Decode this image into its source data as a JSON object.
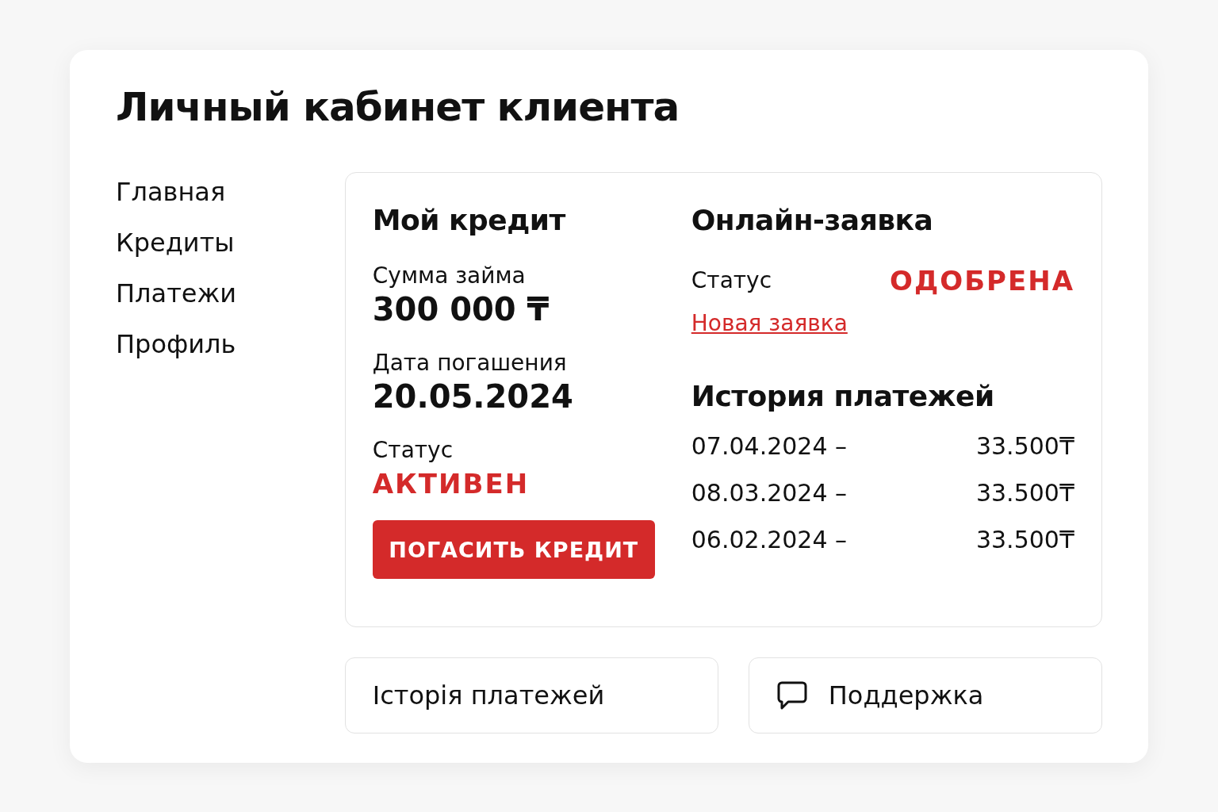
{
  "title": "Личный кабинет клиента",
  "sidebar": {
    "items": [
      {
        "label": "Главная"
      },
      {
        "label": "Кредиты"
      },
      {
        "label": "Платежи"
      },
      {
        "label": "Профиль"
      }
    ]
  },
  "credit": {
    "heading": "Мой кредит",
    "amount_label": "Сумма займа",
    "amount": "300 000 ₸",
    "date_label": "Дата погашения",
    "date": "20.05.2024",
    "status_label": "Статус",
    "status": "АКТИВЕН",
    "button": "ПОГАСИТЬ КРЕДИТ"
  },
  "application": {
    "heading": "Онлайн-заявка",
    "status_label": "Статус",
    "status": "ОДОБРЕНА",
    "link": "Новая заявка"
  },
  "history": {
    "heading": "История платежей",
    "rows": [
      {
        "date": "07.04.2024 –",
        "amount": "33.500₸"
      },
      {
        "date": "08.03.2024 –",
        "amount": "33.500₸"
      },
      {
        "date": "06.02.2024 –",
        "amount": "33.500₸"
      }
    ]
  },
  "bottom_buttons": [
    {
      "kind": "plain",
      "label": "Історія платежей"
    },
    {
      "kind": "chat",
      "label": "Поддержка"
    }
  ]
}
